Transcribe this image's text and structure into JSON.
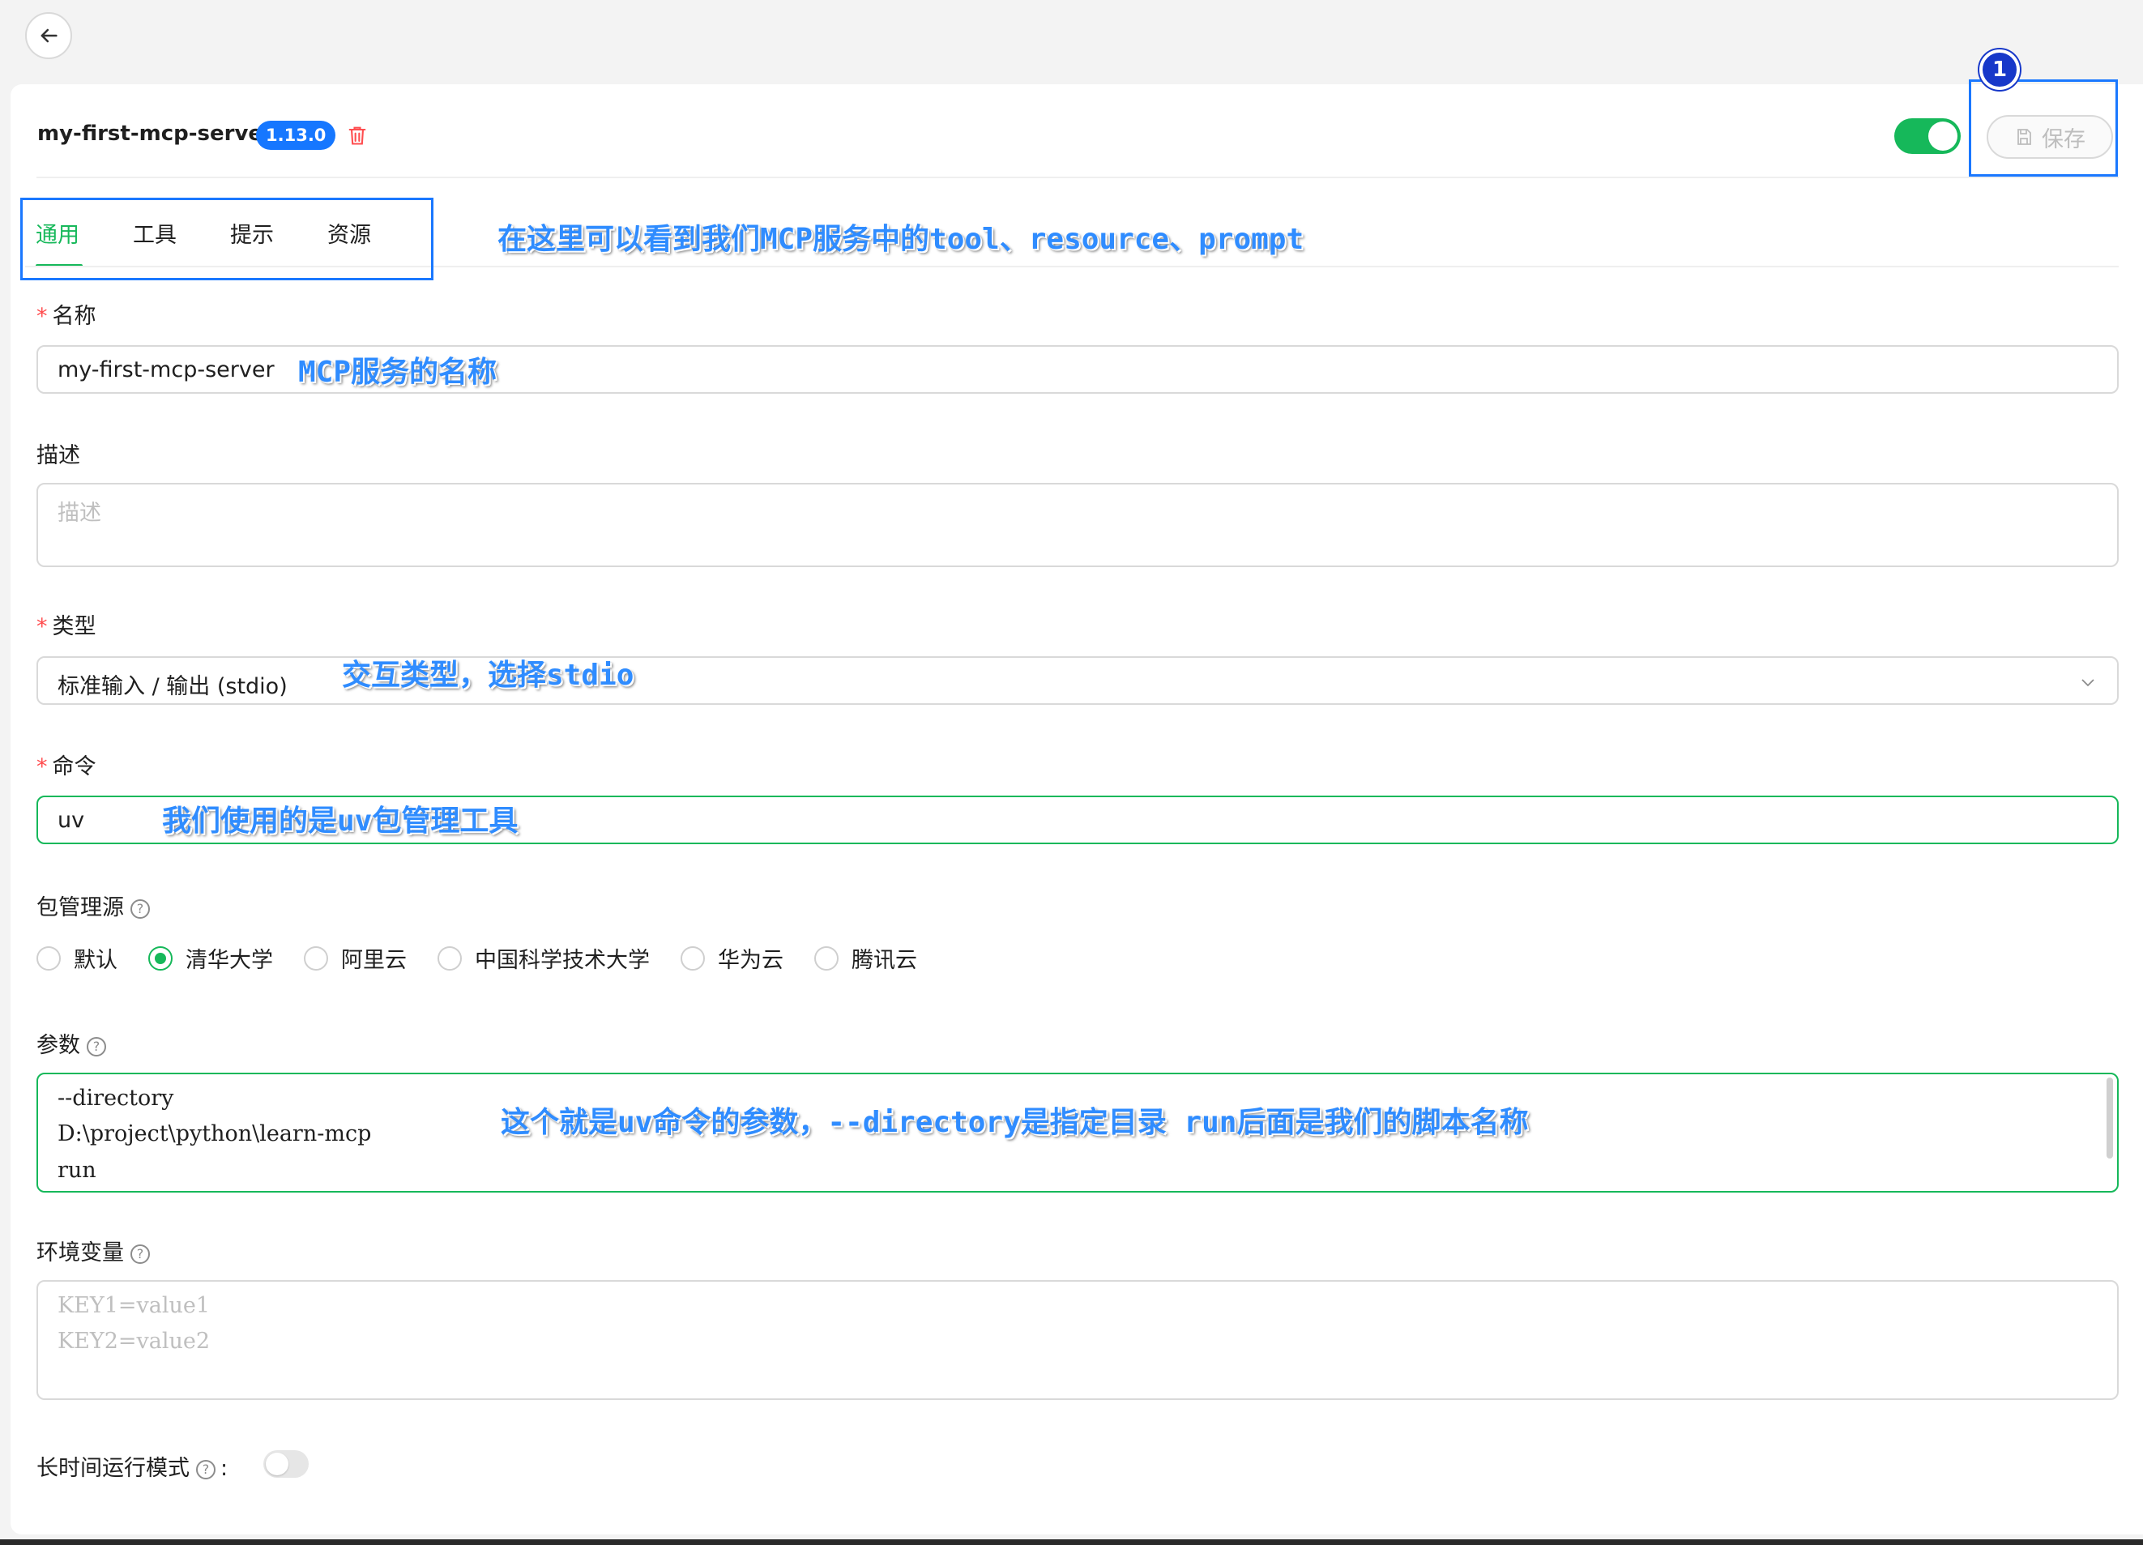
{
  "back_icon": "arrow-left-icon",
  "header": {
    "server_name": "my-first-mcp-server",
    "version": "1.13.0",
    "delete_icon": "trash-icon",
    "enabled": true,
    "save_label": "保存",
    "save_icon": "floppy-disk-icon",
    "callout_number": "1"
  },
  "tabs": [
    {
      "label": "通用",
      "active": true
    },
    {
      "label": "工具",
      "active": false
    },
    {
      "label": "提示",
      "active": false
    },
    {
      "label": "资源",
      "active": false
    }
  ],
  "form": {
    "name": {
      "label": "名称",
      "required": true,
      "value": "my-first-mcp-server"
    },
    "description": {
      "label": "描述",
      "required": false,
      "placeholder": "描述"
    },
    "type": {
      "label": "类型",
      "required": true,
      "value": "标准输入 / 输出 (stdio)"
    },
    "command": {
      "label": "命令",
      "required": true,
      "value": "uv"
    },
    "package_source": {
      "label": "包管理源",
      "options": [
        "默认",
        "清华大学",
        "阿里云",
        "中国科学技术大学",
        "华为云",
        "腾讯云"
      ],
      "selected": "清华大学"
    },
    "args": {
      "label": "参数",
      "lines": [
        "--directory",
        "D:\\project\\python\\learn-mcp",
        "run"
      ]
    },
    "env": {
      "label": "环境变量",
      "placeholder_lines": [
        "KEY1=value1",
        "KEY2=value2"
      ]
    },
    "long_running": {
      "label": "长时间运行模式",
      "colon": ":",
      "enabled": false
    }
  },
  "annotations": {
    "tabs_note": "在这里可以看到我们MCP服务中的tool、resource、prompt",
    "name_note": "MCP服务的名称",
    "type_note": "交互类型，选择stdio",
    "command_note": "我们使用的是uv包管理工具",
    "args_note": "这个就是uv命令的参数，--directory是指定目录 run后面是我们的脚本名称"
  },
  "colors": {
    "accent": "#16b85a",
    "badge": "#1677ff",
    "annotation": "#2f8cff",
    "callout_box": "#1a78ff"
  }
}
